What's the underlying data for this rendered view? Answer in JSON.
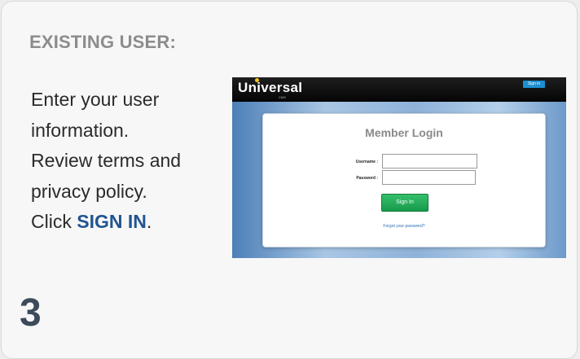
{
  "card": {
    "heading": "EXISTING USER:",
    "instructions": {
      "line1": "Enter your  user",
      "line2": "information.",
      "line3": "Review terms and",
      "line4": "privacy policy.",
      "line5_prefix": "Click ",
      "line5_action": "SIGN IN",
      "line5_suffix": "."
    },
    "step_number": "3"
  },
  "screenshot": {
    "logo_text": "Universal",
    "logo_subtext": "CMS",
    "top_signin_label": "Sign in",
    "login_title": "Member Login",
    "username_label": "Username :",
    "password_label": "Password :",
    "signin_button_label": "Sign In",
    "forgot_link": "Forgot your password?"
  },
  "colors": {
    "heading": "#8c8c8c",
    "cta": "#21558f",
    "step_number": "#3c4a5a",
    "signin_button": "#2aae5c"
  }
}
